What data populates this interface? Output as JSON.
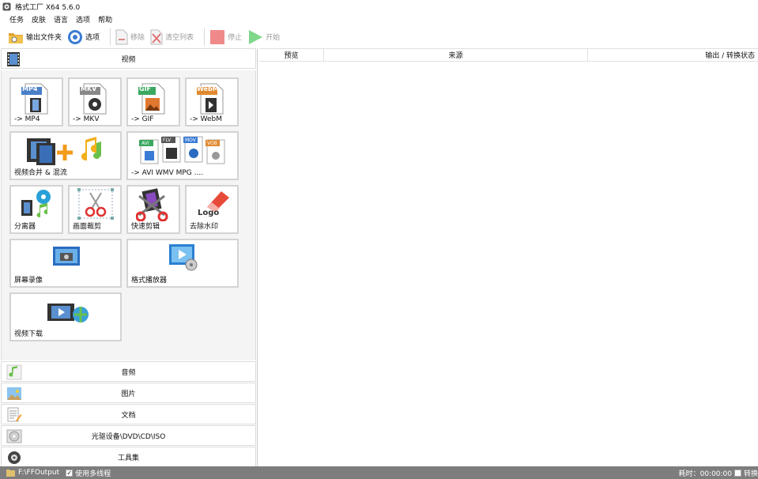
{
  "titlebar": {
    "title": "格式工厂 X64 5.6.0"
  },
  "menu": [
    "任务",
    "皮肤",
    "语言",
    "选项",
    "帮助"
  ],
  "toolbar": {
    "output_folder": "输出文件夹",
    "options": "选项",
    "remove": "移除",
    "clear_list": "清空列表",
    "stop": "停止",
    "start": "开始"
  },
  "categories": {
    "video": "视频",
    "audio": "音频",
    "image": "图片",
    "document": "文档",
    "disc": "光驱设备\\DVD\\CD\\ISO",
    "tools": "工具集"
  },
  "tiles": {
    "mp4": {
      "label": "-> MP4",
      "badge": "MP4"
    },
    "mkv": {
      "label": "-> MKV",
      "badge": "MKV"
    },
    "gif": {
      "label": "-> GIF",
      "badge": "GIF"
    },
    "webm": {
      "label": "-> WebM",
      "badge": "WebM"
    },
    "merge": {
      "label": "视频合并 & 混流"
    },
    "avi": {
      "label": "-> AVI WMV MPG ....",
      "badges": [
        "AVI",
        "FLV",
        "MOV",
        "VOB"
      ]
    },
    "splitter": {
      "label": "分离器"
    },
    "crop": {
      "label": "画面裁剪"
    },
    "quickcut": {
      "label": "快速剪辑"
    },
    "watermark": {
      "label": "去除水印",
      "logo_text": "Logo"
    },
    "recorder": {
      "label": "屏幕录像"
    },
    "player": {
      "label": "格式播放器"
    },
    "download": {
      "label": "视频下载"
    }
  },
  "list": {
    "col_preview": "预览",
    "col_source": "来源",
    "col_output": "输出 / 转换状态"
  },
  "status": {
    "path": "F:\\FFOutput",
    "multithread": "使用多线程",
    "elapsed": "耗时：00:00:00",
    "after_convert": "转换"
  },
  "colors": {
    "status_bar": "#7d7d7d",
    "start_green": "#4ec05a",
    "stop_red": "#f08a8a"
  }
}
